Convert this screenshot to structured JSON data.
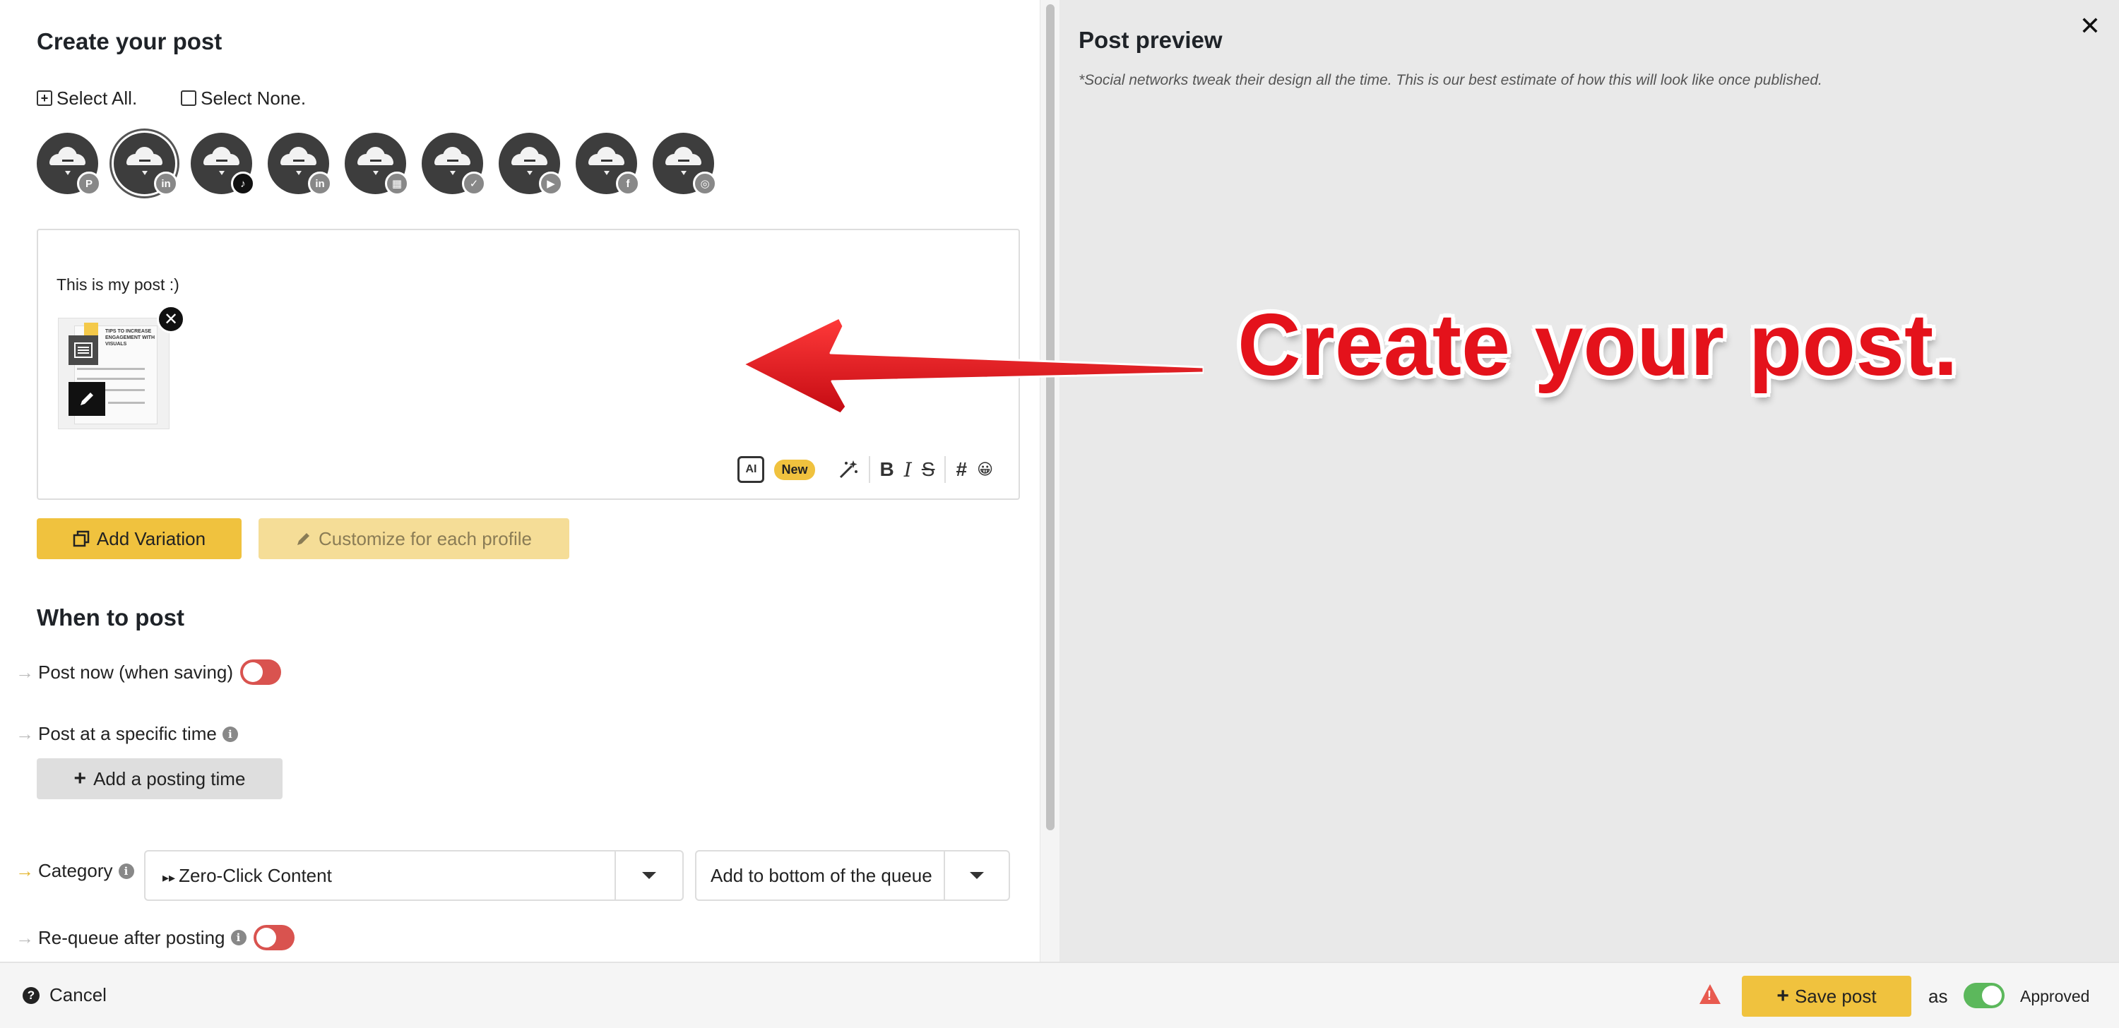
{
  "editor": {
    "title": "Create your post",
    "select_all": "Select All.",
    "select_none": "Select None.",
    "profiles": [
      {
        "network": "pinterest",
        "badge": "P",
        "selected": false
      },
      {
        "network": "linkedin",
        "badge": "in",
        "selected": true
      },
      {
        "network": "tiktok",
        "badge": "♪",
        "selected": false
      },
      {
        "network": "linkedin",
        "badge": "in",
        "selected": false
      },
      {
        "network": "google-business",
        "badge": "▦",
        "selected": false
      },
      {
        "network": "twitter",
        "badge": "✓",
        "selected": false
      },
      {
        "network": "youtube",
        "badge": "▶",
        "selected": false
      },
      {
        "network": "facebook",
        "badge": "f",
        "selected": false
      },
      {
        "network": "instagram",
        "badge": "◎",
        "selected": false
      }
    ],
    "post_text": "This is my post :)",
    "attachment": {
      "thumb_heading": "TIPS TO INCREASE ENGAGEMENT WITH VISUALS",
      "remove_glyph": "✕"
    },
    "toolbar": {
      "ai_label": "AI",
      "new_badge": "New",
      "bold": "B",
      "italic": "I",
      "strike": "S",
      "hashtag": "#",
      "emoji": "😀"
    },
    "add_variation": "Add Variation",
    "customize": "Customize for each profile"
  },
  "schedule": {
    "title": "When to post",
    "post_now": "Post now (when saving)",
    "post_now_on": false,
    "specific_time": "Post at a specific time",
    "add_time": "Add a posting time",
    "category_label": "Category",
    "category_value": "Zero-Click Content",
    "queue_value": "Add to bottom of the queue",
    "requeue_label": "Re-queue after posting",
    "requeue_on": false
  },
  "preview": {
    "title": "Post preview",
    "note": "*Social networks tweak their design all the time. This is our best estimate of how this will look like once published.",
    "close_glyph": "✕"
  },
  "annotation": {
    "callout": "Create your post.",
    "color": "#e4121b"
  },
  "footer": {
    "cancel": "Cancel",
    "save": "Save post",
    "as": "as",
    "approved": "Approved",
    "approved_on": true
  },
  "colors": {
    "accent": "#f0c23e",
    "toggle_off": "#d9534f",
    "toggle_on": "#5cb85c"
  }
}
